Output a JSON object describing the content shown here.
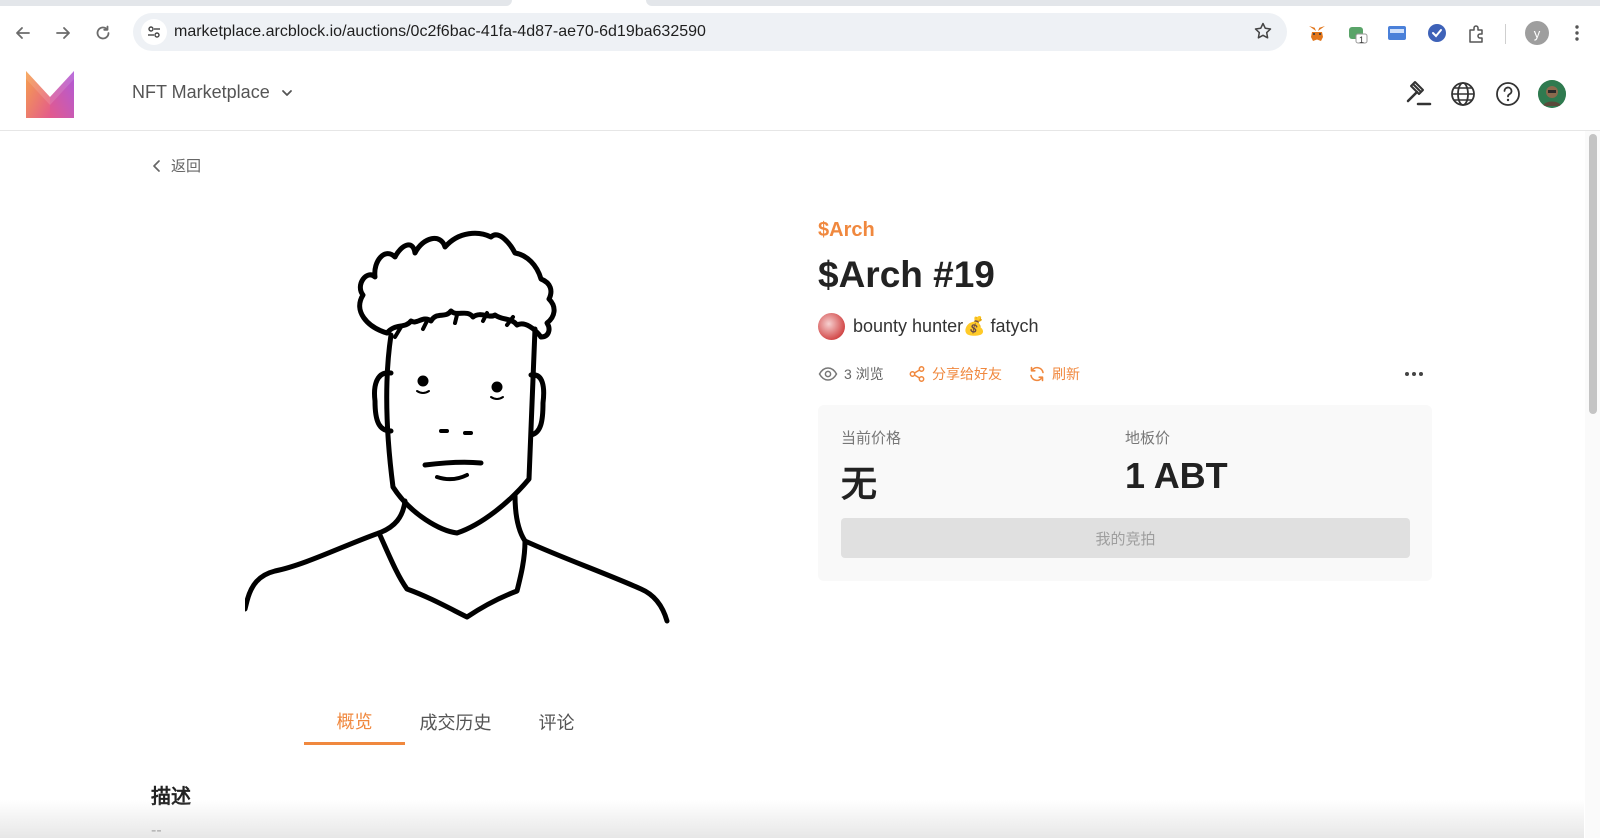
{
  "browser": {
    "url": "marketplace.arcblock.io/auctions/0c2f6bac-41fa-4d87-ae70-6d19ba632590",
    "profile_initial": "y",
    "extension_badge": "1"
  },
  "header": {
    "app_title": "NFT Marketplace"
  },
  "nav": {
    "back_label": "返回"
  },
  "nft": {
    "collection": "$Arch",
    "title": "$Arch #19",
    "owner_name": "bounty hunter💰 fatych",
    "views": "3 浏览",
    "share_label": "分享给好友",
    "refresh_label": "刷新"
  },
  "price": {
    "current_label": "当前价格",
    "current_value": "无",
    "floor_label": "地板价",
    "floor_value": "1 ABT",
    "bid_button": "我的竞拍"
  },
  "tabs": [
    {
      "label": "概览",
      "active": true
    },
    {
      "label": "成交历史",
      "active": false
    },
    {
      "label": "评论",
      "active": false
    }
  ],
  "description": {
    "heading": "描述",
    "value": "--"
  },
  "colors": {
    "accent": "#f0883e",
    "button_disabled": "#e0e0e0"
  }
}
